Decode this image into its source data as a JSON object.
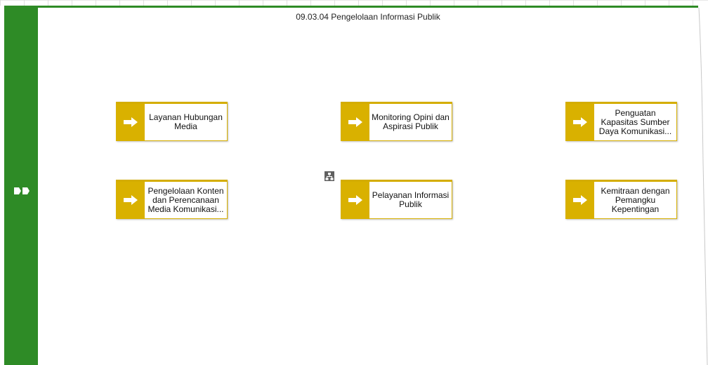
{
  "diagram": {
    "title": "09.03.04 Pengelolaan Informasi Publik",
    "colors": {
      "accent": "#2e8b26",
      "node_badge": "#d9b100",
      "node_border": "#d4ad00"
    },
    "icons": {
      "left_bar": "double-chevron-icon",
      "node": "arrow-right-icon",
      "subprocess": "hierarchy-icon"
    },
    "nodes": [
      {
        "id": "layanan-hubungan-media",
        "label": "Layanan Hubungan Media"
      },
      {
        "id": "monitoring-opini",
        "label": "Monitoring Opini dan Aspirasi Publik"
      },
      {
        "id": "penguatan-kapasitas",
        "label": "Penguatan Kapasitas Sumber Daya Komunikasi..."
      },
      {
        "id": "pengelolaan-konten",
        "label": "Pengelolaan Konten dan Perencanaan Media Komunikasi..."
      },
      {
        "id": "pelayanan-informasi",
        "label": "Pelayanan Informasi Publik"
      },
      {
        "id": "kemitraan",
        "label": "Kemitraan dengan Pemangku Kepentingan"
      }
    ]
  }
}
